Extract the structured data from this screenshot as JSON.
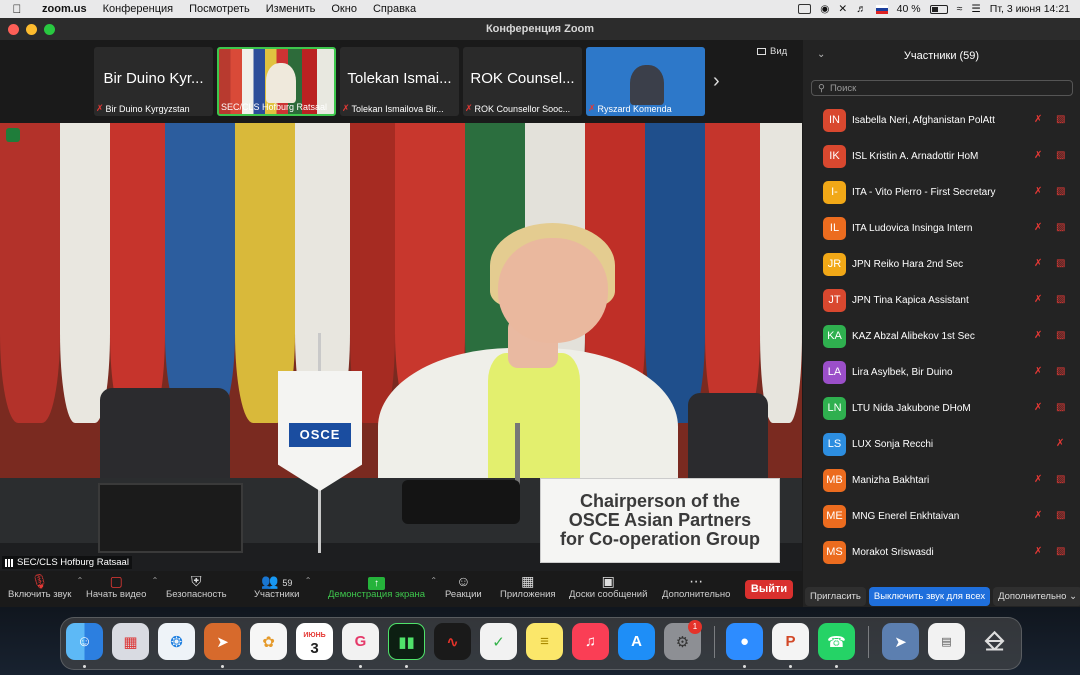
{
  "menubar": {
    "app": "zoom.us",
    "items": [
      "Конференция",
      "Посмотреть",
      "Изменить",
      "Окно",
      "Справка"
    ],
    "battery": "40 %",
    "clock": "Пт, 3 июня  14:21"
  },
  "window": {
    "title": "Конференция Zoom"
  },
  "strip": {
    "view_label": "Вид",
    "thumbs": [
      {
        "big": "Bir Duino Kyr...",
        "caption": "Bir Duino Kyrgyzstan"
      },
      {
        "big": "",
        "caption": "SEC/CLS Hofburg Ratsaal"
      },
      {
        "big": "Tolekan Ismai...",
        "caption": "Tolekan Ismailova Bir..."
      },
      {
        "big": "ROK Counsel...",
        "caption": "ROK Counsellor Sooc..."
      },
      {
        "big": "",
        "caption": "Ryszard Komenda"
      }
    ]
  },
  "video": {
    "speaker_label": "SEC/CLS Hofburg Ratsaal",
    "pennant_text": "OSCE",
    "nameplate": [
      "Chairperson of the",
      "OSCE Asian Partners",
      "for Co-operation Group"
    ]
  },
  "toolbar": {
    "unmute": "Включить звук",
    "start_video": "Начать видео",
    "security": "Безопасность",
    "participants": "Участники",
    "participants_count": "59",
    "share": "Демонстрация экрана",
    "reactions": "Реакции",
    "apps": "Приложения",
    "whiteboards": "Доски сообщений",
    "more": "Дополнительно",
    "leave": "Выйти"
  },
  "panel": {
    "title": "Участники (59)",
    "search_placeholder": "Поиск",
    "invite": "Пригласить",
    "mute_all": "Выключить звук для всех",
    "more": "Дополнительно",
    "participants": [
      {
        "initials": "IN",
        "name": "Isabella Neri, Afghanistan PolAtt",
        "color": "#d9482f",
        "video_off": true
      },
      {
        "initials": "IK",
        "name": "ISL Kristin A. Arnadottir HoM",
        "color": "#d9482f",
        "video_off": true
      },
      {
        "initials": "I-",
        "name": "ITA - Vito Pierro - First Secretary",
        "color": "#f1a817",
        "video_off": true
      },
      {
        "initials": "IL",
        "name": "ITA Ludovica Insinga Intern",
        "color": "#ec6c1f",
        "video_off": true
      },
      {
        "initials": "JR",
        "name": "JPN Reiko Hara 2nd Sec",
        "color": "#f1a817",
        "video_off": true
      },
      {
        "initials": "JT",
        "name": "JPN Tina Kapica Assistant",
        "color": "#d9482f",
        "video_off": true
      },
      {
        "initials": "KA",
        "name": "KAZ Abzal Alibekov 1st Sec",
        "color": "#2fb04f",
        "video_off": true
      },
      {
        "initials": "LA",
        "name": "Lira Asylbek, Bir Duino",
        "color": "#9b4fc9",
        "video_off": true
      },
      {
        "initials": "LN",
        "name": "LTU Nida Jakubone DHoM",
        "color": "#2fb04f",
        "video_off": true
      },
      {
        "initials": "LS",
        "name": "LUX Sonja Recchi",
        "color": "#2d8ee0",
        "video_off": false
      },
      {
        "initials": "MB",
        "name": "Manizha Bakhtari",
        "color": "#ec6c1f",
        "video_off": true
      },
      {
        "initials": "ME",
        "name": "MNG Enerel Enkhtaivan",
        "color": "#ec6c1f",
        "video_off": true
      },
      {
        "initials": "MS",
        "name": "Morakot Sriswasdi",
        "color": "#ec6c1f",
        "video_off": true
      }
    ]
  },
  "dock": {
    "calendar_month": "ИЮНЬ",
    "calendar_day": "3",
    "settings_badge": "1"
  }
}
